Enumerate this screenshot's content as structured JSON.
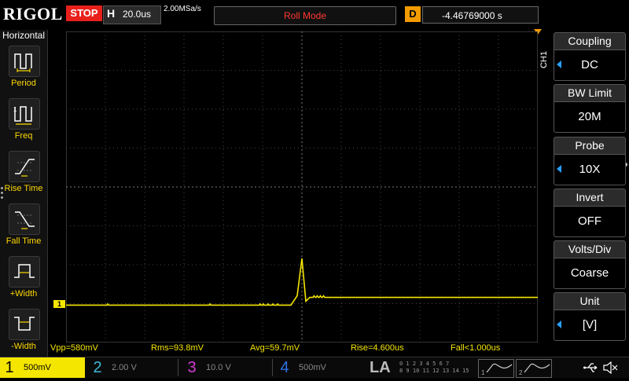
{
  "header": {
    "brand": "RIGOL",
    "run_state": "STOP",
    "timebase_label": "H",
    "timebase_value": "20.0us",
    "sample_rate": "2.00MSa/s",
    "mode": "Roll Mode",
    "delay_label": "D",
    "delay_value": "-4.46769000 s"
  },
  "left_panel": {
    "title": "Horizontal",
    "items": [
      {
        "label": "Period",
        "icon": "period-icon"
      },
      {
        "label": "Freq",
        "icon": "frequency-icon"
      },
      {
        "label": "Rise Time",
        "icon": "rise-time-icon"
      },
      {
        "label": "Fall Time",
        "icon": "fall-time-icon"
      },
      {
        "label": "+Width",
        "icon": "positive-width-icon"
      },
      {
        "label": "-Width",
        "icon": "negative-width-icon"
      }
    ]
  },
  "channel_tag": "CH1",
  "right_panel": {
    "items": [
      {
        "label": "Coupling",
        "value": "DC",
        "has_arrow": true
      },
      {
        "label": "BW Limit",
        "value": "20M",
        "has_arrow": false
      },
      {
        "label": "Probe",
        "value": "10X",
        "has_arrow": true
      },
      {
        "label": "Invert",
        "value": "OFF",
        "has_arrow": false
      },
      {
        "label": "Volts/Div",
        "value": "Coarse",
        "has_arrow": false
      },
      {
        "label": "Unit",
        "value": "[V]",
        "has_arrow": true
      }
    ]
  },
  "measurements": {
    "vpp": "Vpp=580mV",
    "rms": "Rms=93.8mV",
    "avg": "Avg=59.7mV",
    "rise": "Rise=4.600us",
    "fall": "Fall<1.000us"
  },
  "ch1_marker": "1",
  "channels": [
    {
      "number": "1",
      "scale": "500mV",
      "color": "#f5e600",
      "active": true
    },
    {
      "number": "2",
      "scale": "2.00 V",
      "color": "#3fb8d8",
      "active": false
    },
    {
      "number": "3",
      "scale": "10.0 V",
      "color": "#d43cd4",
      "active": false
    },
    {
      "number": "4",
      "scale": "500mV",
      "color": "#2f6fe8",
      "active": false
    }
  ],
  "logic_analyzer": {
    "label": "LA",
    "row1": "0 1 2 3  4 5 6 7",
    "row2": "8 9 10 11 12 13 14 15"
  },
  "trigger_slots": [
    {
      "number": "1"
    },
    {
      "number": "2"
    }
  ],
  "colors": {
    "ch1": "#f5e600",
    "stop": "#e8201c",
    "mode_text": "#ff3a30",
    "delay_badge": "#f39a00",
    "arrow": "#2aa0ff"
  },
  "waveform": {
    "baseline_level": 0.88,
    "spike_peak_level": 0.73,
    "post_level": 0.855
  }
}
